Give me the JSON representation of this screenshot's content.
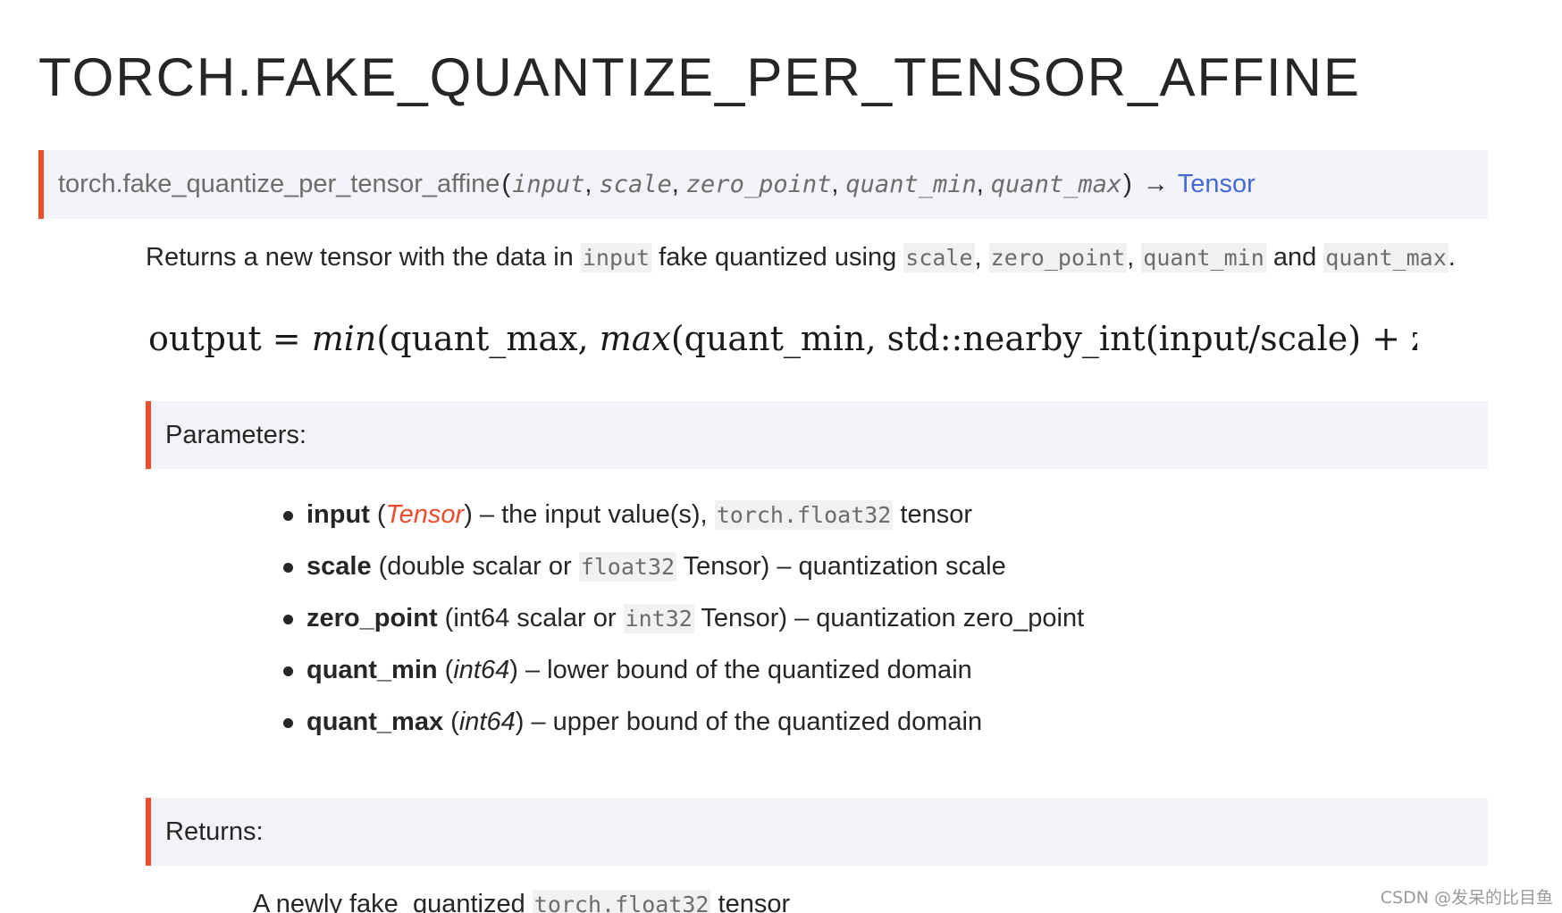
{
  "page": {
    "title": "TORCH.FAKE_QUANTIZE_PER_TENSOR_AFFINE"
  },
  "signature": {
    "function_name": "torch.fake_quantize_per_tensor_affine",
    "open_paren": "(",
    "close_paren": ")",
    "args": [
      "input",
      "scale",
      "zero_point",
      "quant_min",
      "quant_max"
    ],
    "separator": ",",
    "arrow": "→",
    "return_type": "Tensor",
    "colors": {
      "accent": "#ee4c2c",
      "link": "#4569d3",
      "background": "#f3f4f7"
    }
  },
  "description": {
    "prefix": "Returns a new tensor with the data in",
    "code_input": "input",
    "middle": "fake quantized using",
    "code_scale": "scale",
    "comma1": ",",
    "code_zero_point": "zero_point",
    "comma2": ",",
    "code_quant_min": "quant_min",
    "and_text": "and",
    "code_quant_max": "quant_max",
    "period": "."
  },
  "formula": {
    "lhs": "output",
    "eq": " = ",
    "min_fn": "min",
    "part1": "(quant_max, ",
    "max_fn": "max",
    "part2": "(quant_min, std::nearby_int(input/scale) + zero_poi"
  },
  "parameters": {
    "heading": "Parameters:",
    "items": [
      {
        "name": "input",
        "open": " (",
        "type": "Tensor",
        "close": ")",
        "desc_before": " – the input value(s), ",
        "code": "torch.float32",
        "desc_after": " tensor"
      },
      {
        "name": "scale",
        "open": " (double scalar or ",
        "code": "float32",
        "close": " Tensor)",
        "desc": " – quantization scale"
      },
      {
        "name": "zero_point",
        "open": " (int64 scalar or ",
        "code": "int32",
        "close": " Tensor)",
        "desc": " – quantization zero_point"
      },
      {
        "name": "quant_min",
        "open": " (",
        "type": "int64",
        "close": ")",
        "desc": " – lower bound of the quantized domain"
      },
      {
        "name": "quant_max",
        "open": " (",
        "type": "int64",
        "close": ")",
        "desc": " – upper bound of the quantized domain"
      }
    ]
  },
  "returns": {
    "heading": "Returns:",
    "text_before": "A newly fake_quantized ",
    "code": "torch.float32",
    "text_after": " tensor"
  },
  "watermark": "CSDN @发呆的比目鱼"
}
